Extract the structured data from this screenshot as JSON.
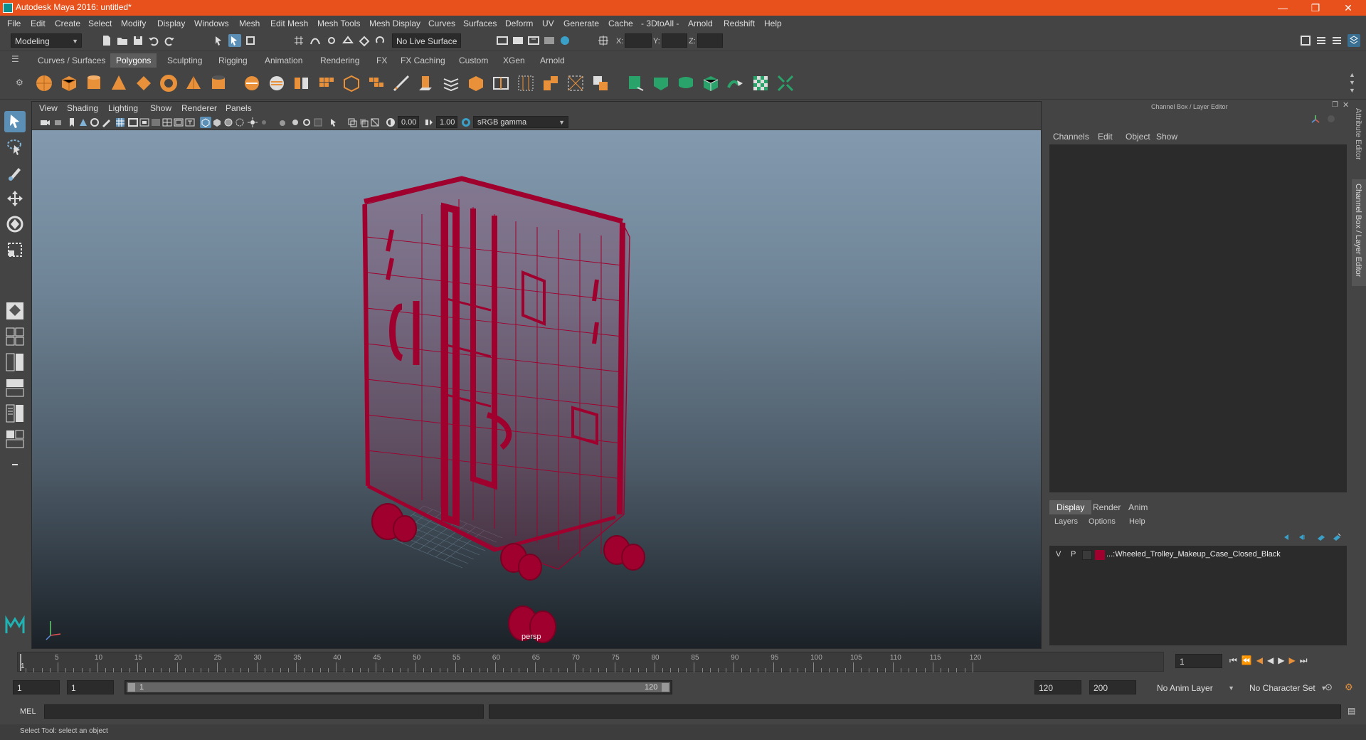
{
  "window": {
    "title": "Autodesk Maya 2016: untitled*",
    "controls": [
      "—",
      "❐",
      "✕"
    ]
  },
  "menubar": [
    "File",
    "Edit",
    "Create",
    "Select",
    "Modify",
    "Display",
    "Windows",
    "Mesh",
    "Edit Mesh",
    "Mesh Tools",
    "Mesh Display",
    "Curves",
    "Surfaces",
    "Deform",
    "UV",
    "Generate",
    "Cache",
    "- 3DtoAll -",
    "Arnold",
    "Redshift",
    "Help"
  ],
  "statusline": {
    "mode": "Modeling",
    "live_surface": "No Live Surface",
    "x_label": "X:",
    "y_label": "Y:",
    "z_label": "Z:"
  },
  "shelf": {
    "tabs": [
      "Curves / Surfaces",
      "Polygons",
      "Sculpting",
      "Rigging",
      "Animation",
      "Rendering",
      "FX",
      "FX Caching",
      "Custom",
      "XGen",
      "Arnold"
    ],
    "active_tab": "Polygons"
  },
  "viewport": {
    "menu": [
      "View",
      "Shading",
      "Lighting",
      "Show",
      "Renderer",
      "Panels"
    ],
    "exposure": "0.00",
    "gamma": "1.00",
    "color_space": "sRGB gamma",
    "camera_label": "persp",
    "mesh_color": "#a0002e"
  },
  "channel_box": {
    "header": "Channel Box / Layer Editor",
    "menu": [
      "Channels",
      "Edit",
      "Object",
      "Show"
    ]
  },
  "layer_editor": {
    "tabs": [
      "Display",
      "Render",
      "Anim"
    ],
    "active_tab": "Display",
    "menu": [
      "Layers",
      "Options",
      "Help"
    ],
    "layers": [
      {
        "visible": "V",
        "playback": "P",
        "color": "#a0002e",
        "name": "...:Wheeled_Trolley_Makeup_Case_Closed_Black"
      }
    ]
  },
  "side_tabs": [
    "Attribute Editor",
    "Channel Box / Layer Editor"
  ],
  "timeline": {
    "ticks": [
      "5",
      "10",
      "15",
      "20",
      "25",
      "30",
      "35",
      "40",
      "45",
      "50",
      "55",
      "60",
      "65",
      "70",
      "75",
      "80",
      "85",
      "90",
      "95",
      "100",
      "105",
      "110",
      "115",
      "120"
    ],
    "start_tick": "1",
    "current_frame": "1"
  },
  "range": {
    "start": "1",
    "playback_start": "1",
    "slider_start": "1",
    "slider_end": "120",
    "playback_end": "120",
    "end": "200",
    "anim_layer": "No Anim Layer",
    "character_set": "No Character Set"
  },
  "command_line": {
    "label": "MEL"
  },
  "help_line": "Select Tool: select an object"
}
